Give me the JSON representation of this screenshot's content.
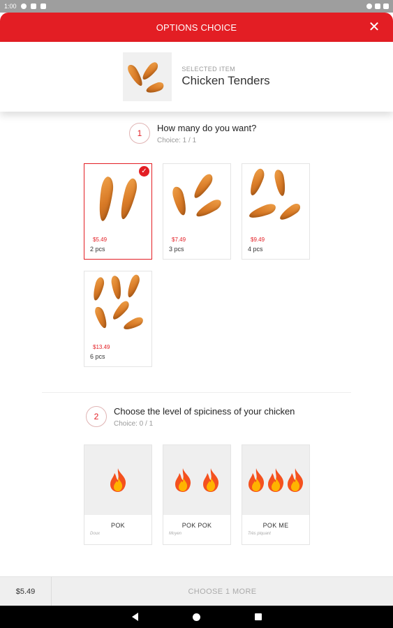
{
  "status_bar": {
    "time": "1:00"
  },
  "header": {
    "title": "OPTIONS CHOICE",
    "close_glyph": "✕"
  },
  "selected_item": {
    "caption": "SELECTED ITEM",
    "name": "Chicken Tenders"
  },
  "section1": {
    "number": "1",
    "question": "How many do you want?",
    "choice": "Choice: 1 / 1",
    "options": [
      {
        "price": "$5.49",
        "qty": "2 pcs",
        "selected": true
      },
      {
        "price": "$7.49",
        "qty": "3 pcs",
        "selected": false
      },
      {
        "price": "$9.49",
        "qty": "4 pcs",
        "selected": false
      },
      {
        "price": "$13.49",
        "qty": "6 pcs",
        "selected": false
      }
    ]
  },
  "section2": {
    "number": "2",
    "question": "Choose the level of spiciness of your chicken",
    "choice": "Choice: 0 / 1",
    "options": [
      {
        "label": "POK",
        "sub": "Doux",
        "flames": 1
      },
      {
        "label": "POK POK",
        "sub": "Moyen",
        "flames": 2
      },
      {
        "label": "POK ME",
        "sub": "Très piquant",
        "flames": 3
      }
    ]
  },
  "footer": {
    "total": "$5.49",
    "action": "CHOOSE 1 MORE"
  },
  "colors": {
    "accent": "#e31e24"
  },
  "icons": {
    "check": "✓"
  }
}
